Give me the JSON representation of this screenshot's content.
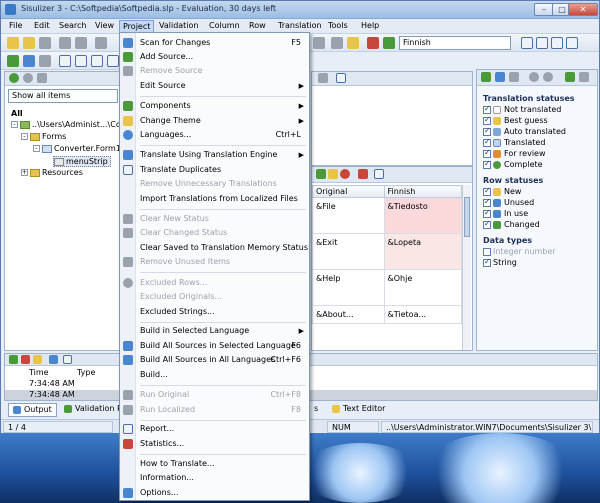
{
  "window": {
    "title": "Sisulizer 3 - C:\\Softpedia\\Softpedia.slp - Evaluation, 30 days left",
    "btn_minimize": "–",
    "btn_maximize": "□",
    "btn_close": "✕"
  },
  "menubar": [
    "File",
    "Edit",
    "Search",
    "View",
    "Project",
    "Validation",
    "Column",
    "Row",
    "Translation",
    "Tools",
    "Help"
  ],
  "toolbar": {
    "language_select": "Finnish"
  },
  "left_panel": {
    "filter_select": "Show all items",
    "tree": {
      "all": "All",
      "path": "..\\Users\\Administ...\\Conv",
      "forms": "Forms",
      "form1": "Converter.Form1",
      "menu": "menuStrip",
      "resources": "Resources"
    }
  },
  "grid": {
    "columns": [
      "Original",
      "Finnish"
    ],
    "rows": [
      {
        "original": "&File",
        "finnish": "&Tiedosto"
      },
      {
        "original": "&Exit",
        "finnish": "&Lopeta"
      },
      {
        "original": "&Help",
        "finnish": "&Ohje"
      },
      {
        "original": "&About...",
        "finnish": "&Tietoa..."
      }
    ]
  },
  "right_panel": {
    "translation_statuses_title": "Translation statuses",
    "translation_statuses": [
      "Not translated",
      "Best guess",
      "Auto translated",
      "Translated",
      "For review",
      "Complete"
    ],
    "row_statuses_title": "Row statuses",
    "row_statuses": [
      "New",
      "Unused",
      "In use",
      "Changed"
    ],
    "data_types_title": "Data types",
    "data_types": [
      "Integer number",
      "String"
    ]
  },
  "log": {
    "columns": [
      "Time",
      "Type"
    ],
    "rows": [
      "7:34:48 AM",
      "7:34:48 AM"
    ]
  },
  "bottom_tabs": {
    "output": "Output",
    "validation": "Validation Re",
    "s": "s",
    "text_editor": "Text Editor"
  },
  "statusbar": {
    "position": "1 / 4",
    "num": "NUM",
    "path": "..\\Users\\Administrator.WIN7\\Documents\\Sisulizer 3\\NET"
  },
  "project_menu": [
    {
      "label": "Scan for Changes",
      "shortcut": "F5",
      "enabled": true
    },
    {
      "label": "Add Source...",
      "enabled": true
    },
    {
      "label": "Remove Source",
      "enabled": false
    },
    {
      "label": "Edit Source",
      "submenu": true,
      "enabled": true
    },
    {
      "sep": true
    },
    {
      "label": "Components",
      "submenu": true,
      "enabled": true
    },
    {
      "label": "Change Theme",
      "submenu": true,
      "enabled": true
    },
    {
      "label": "Languages...",
      "shortcut": "Ctrl+L",
      "enabled": true
    },
    {
      "sep": true
    },
    {
      "label": "Translate Using Translation Engine",
      "submenu": true,
      "enabled": true
    },
    {
      "label": "Translate Duplicates",
      "enabled": true
    },
    {
      "label": "Remove Unnecessary Translations",
      "enabled": false
    },
    {
      "label": "Import Translations from Localized Files",
      "enabled": true
    },
    {
      "sep": true
    },
    {
      "label": "Clear New Status",
      "enabled": false
    },
    {
      "label": "Clear Changed Status",
      "enabled": false
    },
    {
      "label": "Clear Saved to Translation Memory Status",
      "enabled": true
    },
    {
      "label": "Remove Unused Items",
      "enabled": false
    },
    {
      "sep": true
    },
    {
      "label": "Excluded Rows...",
      "enabled": false
    },
    {
      "label": "Excluded Originals...",
      "enabled": false
    },
    {
      "label": "Excluded Strings...",
      "enabled": true
    },
    {
      "sep": true
    },
    {
      "label": "Build in Selected Language",
      "submenu": true,
      "enabled": true
    },
    {
      "label": "Build All Sources in Selected Language",
      "shortcut": "F6",
      "enabled": true
    },
    {
      "label": "Build All Sources in All Languages",
      "shortcut": "Ctrl+F6",
      "enabled": true
    },
    {
      "label": "Build...",
      "enabled": true
    },
    {
      "sep": true
    },
    {
      "label": "Run Original",
      "shortcut": "Ctrl+F8",
      "enabled": false
    },
    {
      "label": "Run Localized",
      "shortcut": "F8",
      "enabled": false
    },
    {
      "sep": true
    },
    {
      "label": "Report...",
      "enabled": true
    },
    {
      "label": "Statistics...",
      "enabled": true
    },
    {
      "sep": true
    },
    {
      "label": "How to Translate...",
      "enabled": true
    },
    {
      "label": "Information...",
      "enabled": true
    },
    {
      "label": "Options...",
      "enabled": true
    }
  ],
  "colors": {
    "accent": "#4a86cf",
    "highlight_pink": "#f9d9d9",
    "menu_selected": "#c6daf5"
  }
}
